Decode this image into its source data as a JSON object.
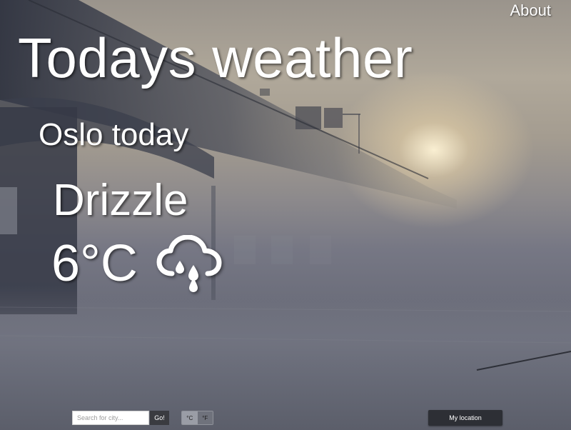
{
  "nav": {
    "about_label": "About"
  },
  "header": {
    "title": "Todays weather"
  },
  "weather": {
    "city_heading": "Oslo today",
    "condition": "Drizzle",
    "temperature": "6°C",
    "condition_icon": "cloud-drizzle-icon"
  },
  "controls": {
    "search_placeholder": "Search for city...",
    "go_label": "Go!",
    "unit_celsius": "°C",
    "unit_fahrenheit": "°F",
    "active_unit": "°C",
    "my_location_label": "My location"
  },
  "colors": {
    "text": "#ffffff",
    "button_dark": "#3a3b40",
    "location_button": "#2d2f35"
  }
}
